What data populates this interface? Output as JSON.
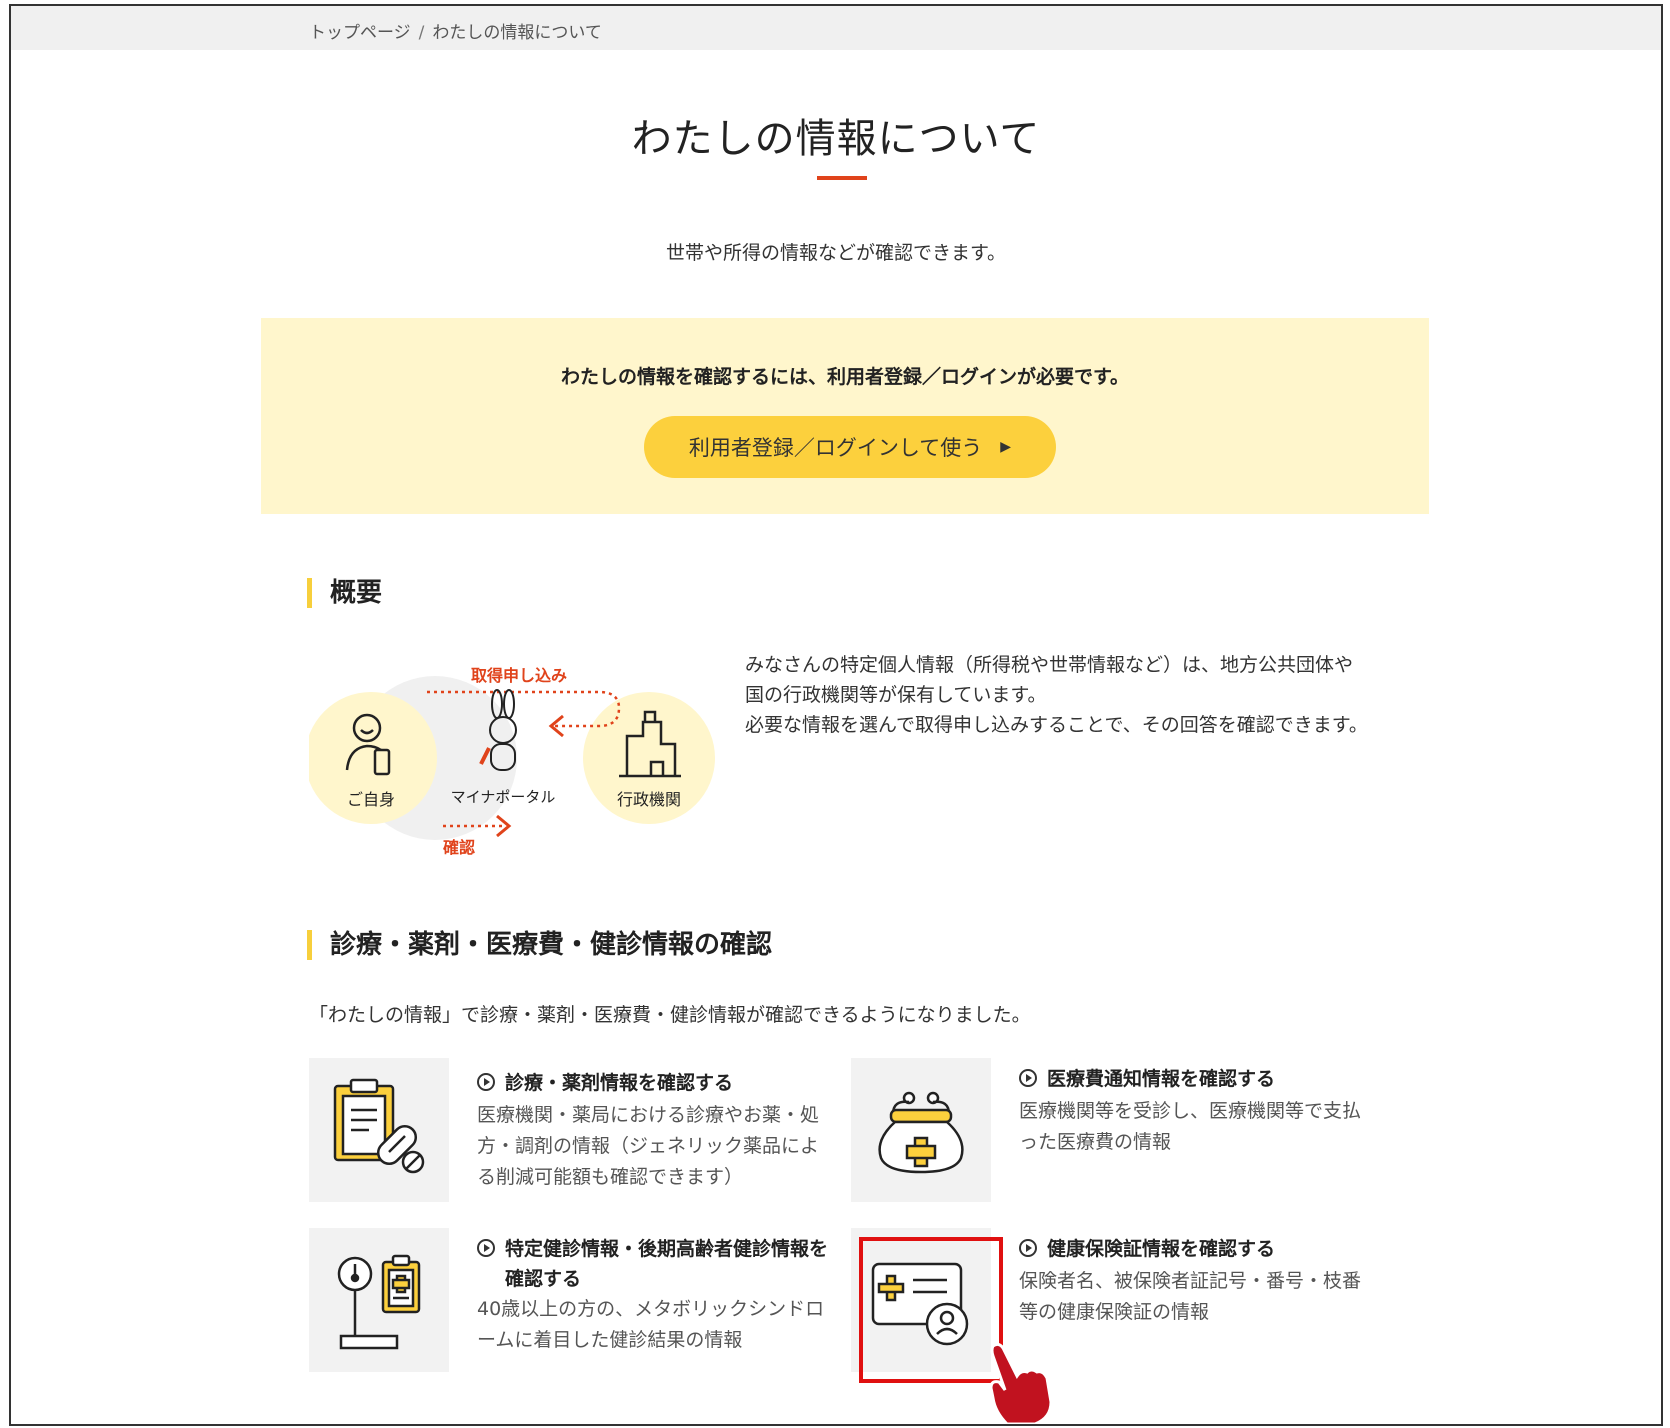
{
  "breadcrumb": {
    "home": "トップページ",
    "separator": "/",
    "current": "わたしの情報について"
  },
  "page": {
    "title": "わたしの情報について",
    "subtitle": "世帯や所得の情報などが確認できます。"
  },
  "notice": {
    "text": "わたしの情報を確認するには、利用者登録／ログインが必要です。",
    "button_label": "利用者登録／ログインして使う",
    "button_arrow": "▶"
  },
  "overview": {
    "heading": "概要",
    "diagram": {
      "top_arrow_label": "取得申し込み",
      "bottom_arrow_label": "確認",
      "self_label": "ご自身",
      "portal_label": "マイナポータル",
      "agency_label": "行政機関"
    },
    "lines": [
      "みなさんの特定個人情報（所得税や世帯情報など）は、地方公共団体や",
      "国の行政機関等が保有しています。",
      "必要な情報を選んで取得申し込みすることで、その回答を確認できます。"
    ]
  },
  "medical": {
    "heading": "診療・薬剤・医療費・健診情報の確認",
    "intro": "「わたしの情報」で診療・薬剤・医療費・健診情報が確認できるようになりました。",
    "cards": [
      {
        "link": "診療・薬剤情報を確認する",
        "desc": [
          "医療機関・薬局における診療やお薬・処",
          "方・調剤の情報（ジェネリック薬品によ",
          "る削減可能額も確認できます）"
        ]
      },
      {
        "link": "医療費通知情報を確認する",
        "desc": [
          "医療機関等を受診し、医療機関等で支払",
          "った医療費の情報"
        ]
      },
      {
        "link_lines": [
          "特定健診情報・後期高齢者健診情報を",
          "確認する"
        ],
        "desc": [
          "40歳以上の方の、メタボリックシンドロ",
          "ームに着目した健診結果の情報"
        ]
      },
      {
        "link": "健康保険証情報を確認する",
        "desc": [
          "保険者名、被保険者証記号・番号・枝番",
          "等の健康保険証の情報"
        ]
      }
    ]
  },
  "colors": {
    "accent_red": "#e0431b",
    "button_yellow": "#fcd03d",
    "notice_bg": "#fff6cc",
    "heading_bar": "#f7cf3c",
    "highlight_red": "#e01010"
  },
  "icons": {
    "card1": "clipboard-pills-icon",
    "card2": "wallet-cross-icon",
    "card3": "scale-clipboard-icon",
    "card4": "insurance-card-icon",
    "pointer": "hand-pointer-icon"
  }
}
